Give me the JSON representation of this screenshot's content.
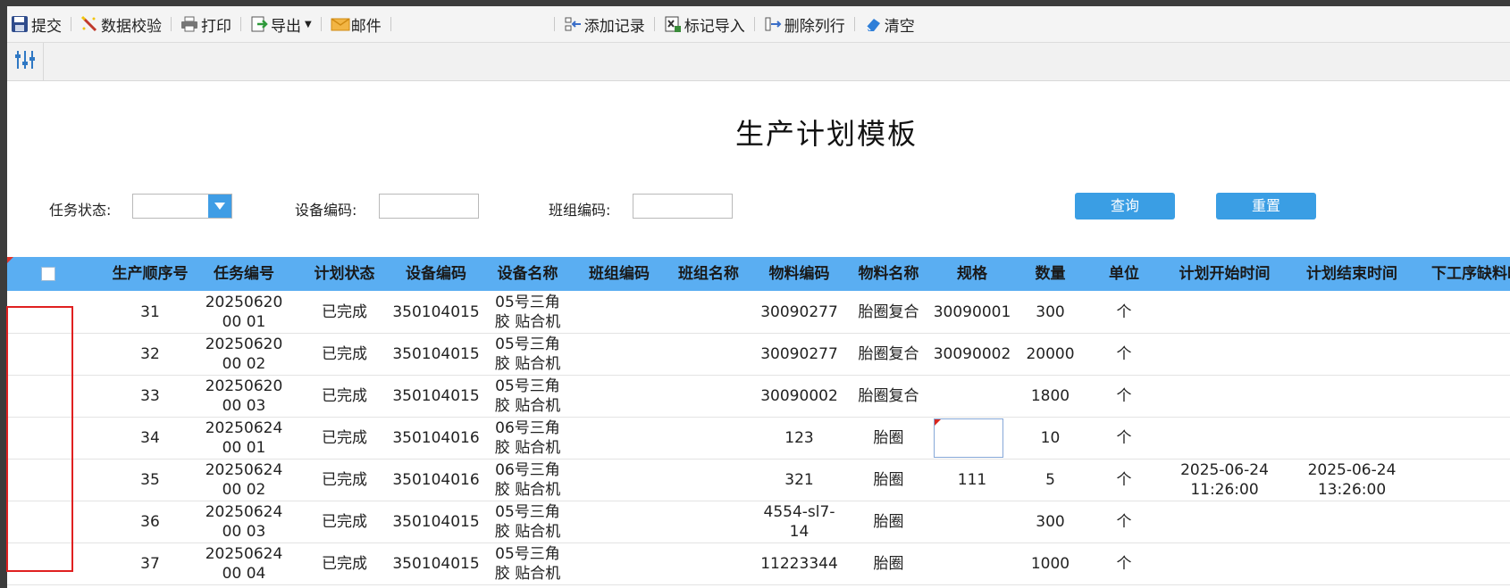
{
  "toolbar": {
    "submit": "提交",
    "validate": "数据校验",
    "print": "打印",
    "export": "导出",
    "mail": "邮件",
    "add_record": "添加记录",
    "mark_import": "标记导入",
    "delete_row": "删除列行",
    "clear": "清空"
  },
  "report": {
    "title": "生产计划模板"
  },
  "filters": {
    "task_status_label": "任务状态:",
    "task_status_value": "",
    "equipment_code_label": "设备编码:",
    "equipment_code_value": "",
    "team_code_label": "班组编码:",
    "team_code_value": "",
    "query_button": "查询",
    "reset_button": "重置"
  },
  "table": {
    "columns": [
      "生产顺序号",
      "任务编号",
      "计划状态",
      "设备编码",
      "设备名称",
      "班组编码",
      "班组名称",
      "物料编码",
      "物料名称",
      "规格",
      "数量",
      "单位",
      "计划开始时间",
      "计划结束时间",
      "下工序缺料时"
    ],
    "rows": [
      {
        "seq": "31",
        "task": "2025062000 01",
        "status": "已完成",
        "equip_code": "350104015",
        "equip_name": "05号三角胶 贴合机",
        "team_code": "",
        "team_name": "",
        "mat_code": "30090277",
        "mat_name": "胎圈复合",
        "spec": "30090001",
        "qty": "300",
        "unit": "个",
        "start": "",
        "end": ""
      },
      {
        "seq": "32",
        "task": "2025062000 02",
        "status": "已完成",
        "equip_code": "350104015",
        "equip_name": "05号三角胶 贴合机",
        "team_code": "",
        "team_name": "",
        "mat_code": "30090277",
        "mat_name": "胎圈复合",
        "spec": "30090002",
        "qty": "20000",
        "unit": "个",
        "start": "",
        "end": ""
      },
      {
        "seq": "33",
        "task": "2025062000 03",
        "status": "已完成",
        "equip_code": "350104015",
        "equip_name": "05号三角胶 贴合机",
        "team_code": "",
        "team_name": "",
        "mat_code": "30090002",
        "mat_name": "胎圈复合",
        "spec": "",
        "qty": "1800",
        "unit": "个",
        "start": "",
        "end": ""
      },
      {
        "seq": "34",
        "task": "2025062400 01",
        "status": "已完成",
        "equip_code": "350104016",
        "equip_name": "06号三角胶 贴合机",
        "team_code": "",
        "team_name": "",
        "mat_code": "123",
        "mat_name": "胎圈",
        "spec": "",
        "qty": "10",
        "unit": "个",
        "start": "",
        "end": ""
      },
      {
        "seq": "35",
        "task": "2025062400 02",
        "status": "已完成",
        "equip_code": "350104016",
        "equip_name": "06号三角胶 贴合机",
        "team_code": "",
        "team_name": "",
        "mat_code": "321",
        "mat_name": "胎圈",
        "spec": "111",
        "qty": "5",
        "unit": "个",
        "start": "2025-06-24 11:26:00",
        "end": "2025-06-24 13:26:00"
      },
      {
        "seq": "36",
        "task": "2025062400 03",
        "status": "已完成",
        "equip_code": "350104015",
        "equip_name": "05号三角胶 贴合机",
        "team_code": "",
        "team_name": "",
        "mat_code": "4554-sl7- 14",
        "mat_name": "胎圈",
        "spec": "",
        "qty": "300",
        "unit": "个",
        "start": "",
        "end": ""
      },
      {
        "seq": "37",
        "task": "2025062400 04",
        "status": "已完成",
        "equip_code": "350104015",
        "equip_name": "05号三角胶 贴合机",
        "team_code": "",
        "team_name": "",
        "mat_code": "11223344",
        "mat_name": "胎圈",
        "spec": "",
        "qty": "1000",
        "unit": "个",
        "start": "",
        "end": ""
      }
    ]
  },
  "colors": {
    "header_bg": "#5aaef2",
    "button_bg": "#3a9ee4",
    "selection_border": "#e02020"
  }
}
